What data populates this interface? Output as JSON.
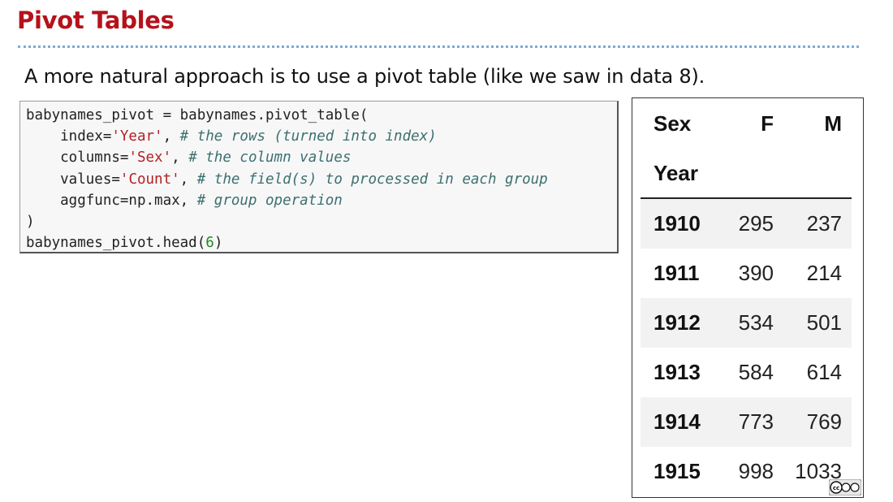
{
  "slide": {
    "title": "Pivot Tables",
    "subtitle": "A more natural approach is to use a pivot table (like we saw in data 8)."
  },
  "code": {
    "lines": [
      [
        {
          "t": "plain",
          "s": "babynames_pivot = babynames.pivot_table("
        }
      ],
      [
        {
          "t": "plain",
          "s": "    index="
        },
        {
          "t": "str",
          "s": "'Year'"
        },
        {
          "t": "plain",
          "s": ", "
        },
        {
          "t": "cmt",
          "s": "# the rows (turned into index)"
        }
      ],
      [
        {
          "t": "plain",
          "s": "    columns="
        },
        {
          "t": "str",
          "s": "'Sex'"
        },
        {
          "t": "plain",
          "s": ", "
        },
        {
          "t": "cmt",
          "s": "# the column values"
        }
      ],
      [
        {
          "t": "plain",
          "s": "    values="
        },
        {
          "t": "str",
          "s": "'Count'"
        },
        {
          "t": "plain",
          "s": ", "
        },
        {
          "t": "cmt",
          "s": "# the field(s) to processed in each group"
        }
      ],
      [
        {
          "t": "plain",
          "s": "    aggfunc=np.max, "
        },
        {
          "t": "cmt",
          "s": "# group operation"
        }
      ],
      [
        {
          "t": "plain",
          "s": ")"
        }
      ],
      [
        {
          "t": "plain",
          "s": "babynames_pivot.head("
        },
        {
          "t": "num",
          "s": "6"
        },
        {
          "t": "plain",
          "s": ")"
        }
      ]
    ]
  },
  "pivot_table": {
    "columns_label": "Sex",
    "col_f": "F",
    "col_m": "M",
    "index_label": "Year",
    "rows": [
      {
        "year": "1910",
        "f": "295",
        "m": "237"
      },
      {
        "year": "1911",
        "f": "390",
        "m": "214"
      },
      {
        "year": "1912",
        "f": "534",
        "m": "501"
      },
      {
        "year": "1913",
        "f": "584",
        "m": "614"
      },
      {
        "year": "1914",
        "f": "773",
        "m": "769"
      },
      {
        "year": "1915",
        "f": "998",
        "m": "1033"
      }
    ]
  },
  "colors": {
    "title": "#b5121b",
    "string": "#b22222",
    "comment": "#3d6f6f",
    "number": "#228b22",
    "row_stripe": "#f2f2f2"
  },
  "icons": [
    "cc-license-icon"
  ]
}
